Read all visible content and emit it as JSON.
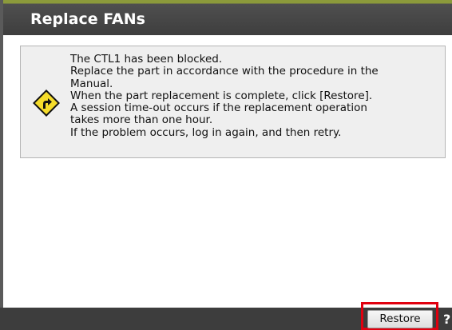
{
  "dialog": {
    "title": "Replace FANs"
  },
  "message": {
    "icon": "warning-road-sign-icon",
    "lines": [
      "The CTL1 has been blocked.",
      "Replace the part in accordance with the procedure in the",
      "Manual.",
      "When the part replacement is complete, click [Restore].",
      "A session time-out occurs if the replacement operation",
      "takes more than one hour.",
      "If the problem occurs, log in again, and then retry."
    ]
  },
  "footer": {
    "restore_label": "Restore",
    "help_label": "?"
  },
  "colors": {
    "title_bar": "#3e3e3e",
    "footer": "#3d3d3d",
    "message_background": "#efefef",
    "highlight": "#e0000f",
    "warning_icon": "#f5dc2b"
  }
}
